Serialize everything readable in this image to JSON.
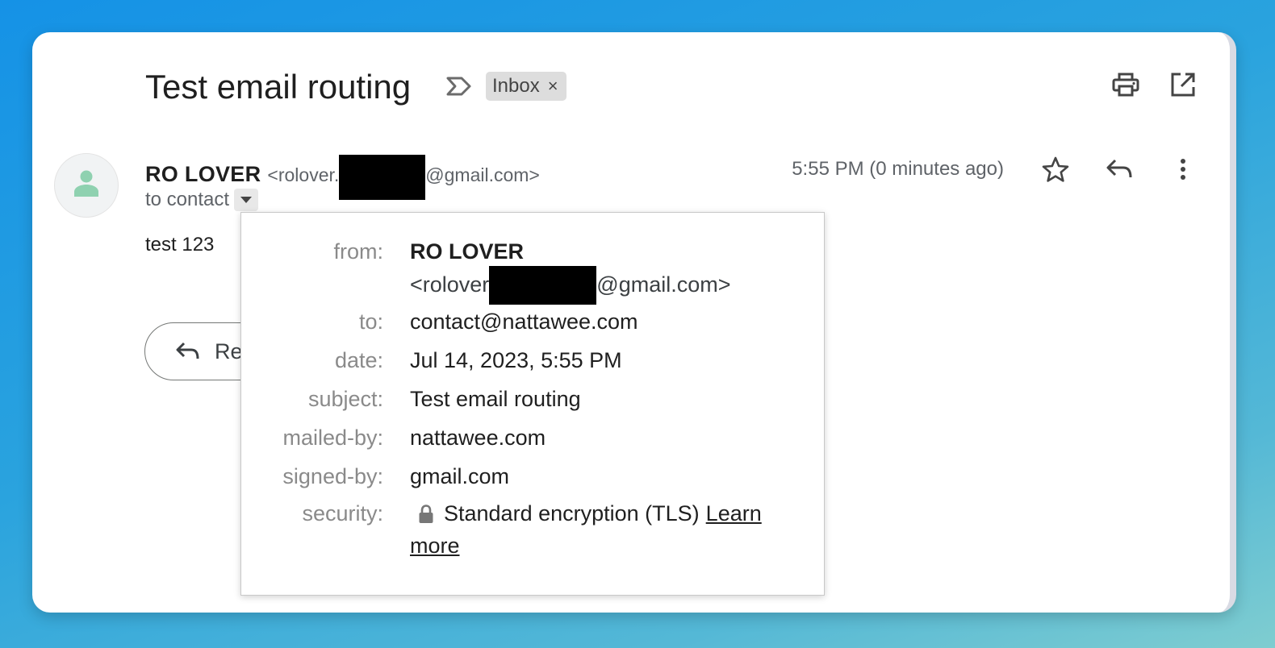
{
  "email": {
    "subject": "Test email routing",
    "label": "Inbox",
    "label_remove": "×",
    "sender_name": "RO LOVER",
    "sender_email_prefix": "<rolover.",
    "sender_email_suffix": "@gmail.com>",
    "to_line": "to contact",
    "timestamp": "5:55 PM (0 minutes ago)",
    "body": "test 123",
    "reply_label": "Reply"
  },
  "details": {
    "from_key": "from:",
    "from_name": "RO LOVER",
    "from_email_prefix": "<rolover",
    "from_email_suffix": "@gmail.com>",
    "to_key": "to:",
    "to_value": "contact@nattawee.com",
    "date_key": "date:",
    "date_value": "Jul 14, 2023, 5:55 PM",
    "subject_key": "subject:",
    "subject_value": "Test email routing",
    "mailedby_key": "mailed-by:",
    "mailedby_value": "nattawee.com",
    "signedby_key": "signed-by:",
    "signedby_value": "gmail.com",
    "security_key": "security:",
    "security_value": "Standard encryption (TLS)",
    "learn_more_1": "Learn",
    "learn_more_2": "more"
  },
  "icons": {
    "label": "label-outline-icon",
    "print": "print-icon",
    "open_new": "open-in-new-icon",
    "star": "star-outline-icon",
    "reply": "reply-icon",
    "more": "more-vert-icon",
    "avatar": "person-icon",
    "dropdown": "caret-down-icon",
    "lock": "lock-icon"
  },
  "colors": {
    "avatar_person": "#8fd1b0",
    "chip_bg": "#dddddd",
    "redaction": "#000000"
  }
}
